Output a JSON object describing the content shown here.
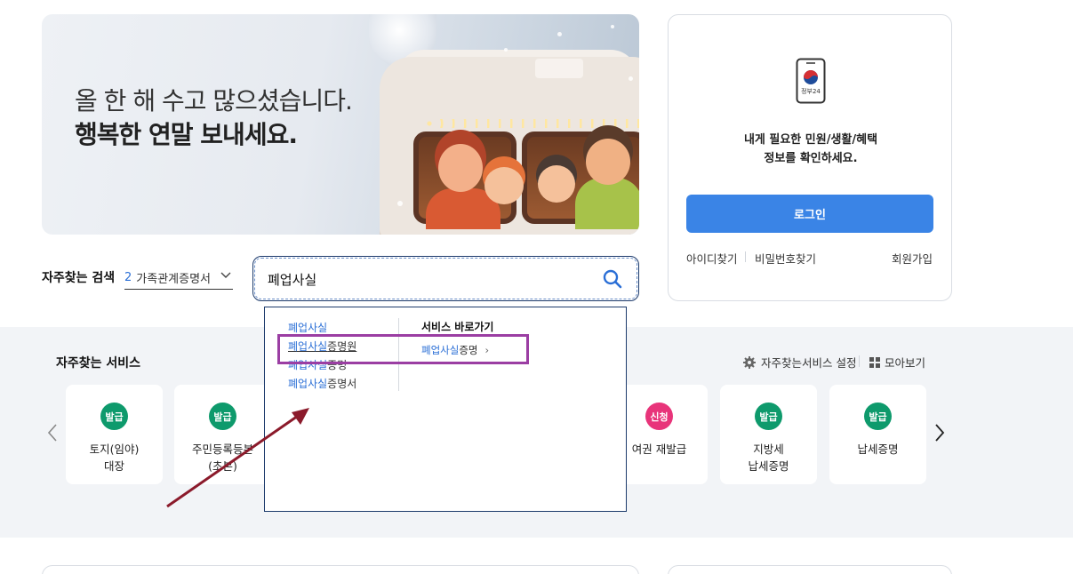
{
  "banner": {
    "line1": "올 한 해 수고 많으셨습니다.",
    "line2": "행복한 연말 보내세요."
  },
  "search": {
    "frequent_label": "자주찾는 검색",
    "frequent_rank": "2",
    "frequent_term": "가족관계증명서",
    "query": "폐업사실",
    "autocomplete": {
      "suggestions": [
        {
          "match": "폐업사실",
          "rest": ""
        },
        {
          "match": "폐업사실",
          "rest": "증명원"
        },
        {
          "match": "폐업사실",
          "rest": "증명"
        },
        {
          "match": "폐업사실",
          "rest": "증명서"
        }
      ],
      "shortcut_heading": "서비스 바로가기",
      "shortcut": {
        "match": "폐업사실",
        "rest": "증명",
        "arrow": "›"
      }
    }
  },
  "login": {
    "app_label": "정부24",
    "desc_line1": "내게 필요한 민원/생활/혜택",
    "desc_line2": "정보를 확인하세요.",
    "login_button": "로그인",
    "find_id": "아이디찾기",
    "find_password": "비밀번호찾기",
    "signup": "회원가입"
  },
  "services": {
    "title": "자주찾는 서비스",
    "settings_label": "자주찾는서비스 설정",
    "view_all_label": "모아보기",
    "prev_arrow": "‹",
    "next_arrow": "›",
    "cards": [
      {
        "badge": "발급",
        "line1": "토지(임야)",
        "line2": "대장"
      },
      {
        "badge": "발급",
        "line1": "주민등록등본",
        "line2": "(초본)"
      },
      {
        "badge": "신청",
        "line1": "여권 재발급",
        "line2": ""
      },
      {
        "badge": "발급",
        "line1": "지방세",
        "line2": "납세증명"
      },
      {
        "badge": "발급",
        "line1": "납세증명",
        "line2": ""
      }
    ]
  },
  "colors": {
    "accent": "#3a84e6",
    "issue_badge": "#0e9a6c",
    "apply_badge": "#e8347a",
    "annotation_box": "#9b3ea3",
    "annotation_arrow": "#8b1a2b"
  }
}
